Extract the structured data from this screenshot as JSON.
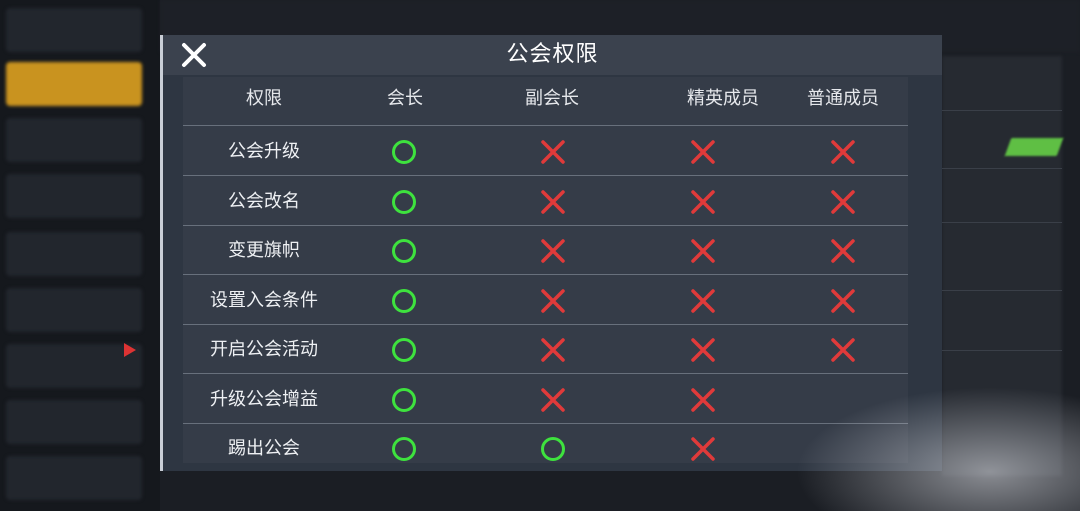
{
  "dialog": {
    "title": "公会权限",
    "close_icon": "close-icon"
  },
  "table": {
    "columns": [
      "权限",
      "会长",
      "副会长",
      "精英成员",
      "普通成员"
    ],
    "rows": [
      {
        "name": "公会升级",
        "perms": [
          "yes",
          "no",
          "no",
          "no"
        ]
      },
      {
        "name": "公会改名",
        "perms": [
          "yes",
          "no",
          "no",
          "no"
        ]
      },
      {
        "name": "变更旗帜",
        "perms": [
          "yes",
          "no",
          "no",
          "no"
        ]
      },
      {
        "name": "设置入会条件",
        "perms": [
          "yes",
          "no",
          "no",
          "no"
        ]
      },
      {
        "name": "开启公会活动",
        "perms": [
          "yes",
          "no",
          "no",
          "no"
        ]
      },
      {
        "name": "升级公会增益",
        "perms": [
          "yes",
          "no",
          "no",
          ""
        ]
      },
      {
        "name": "踢出公会",
        "perms": [
          "yes",
          "yes",
          "no",
          ""
        ]
      }
    ]
  },
  "colors": {
    "allowed": "#3ee23e",
    "denied": "#e03a3a"
  }
}
